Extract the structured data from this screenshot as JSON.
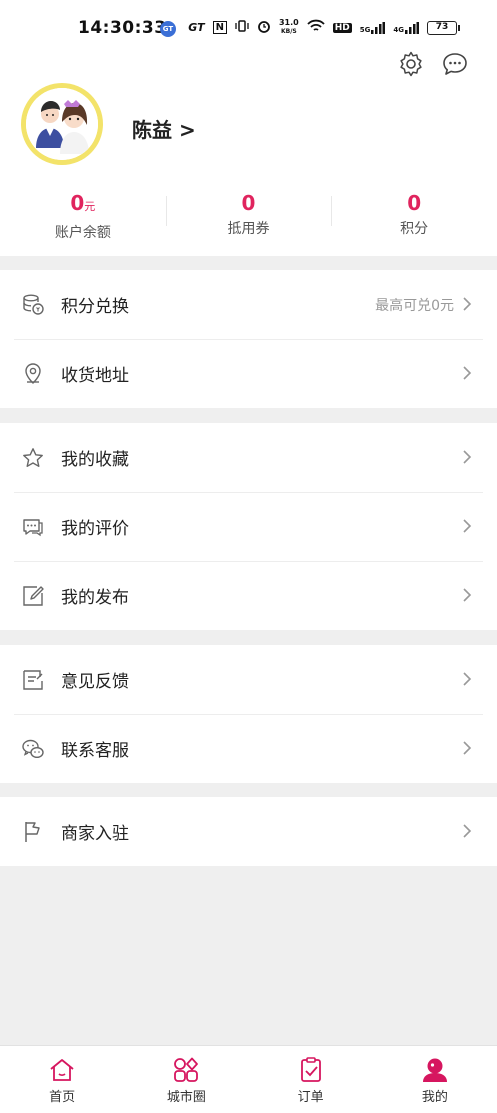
{
  "status_bar": {
    "time": "14:30:33",
    "app_badge": "GT",
    "carrier_tag": "GT",
    "nfc": "N",
    "net_speed_value": "31.0",
    "net_speed_unit": "KB/S",
    "hd_badge": "HD",
    "signal_1": "5G",
    "signal_2": "4G",
    "battery": "73"
  },
  "profile": {
    "username": "陈益 >",
    "stats": [
      {
        "value": "0",
        "unit": "元",
        "label": "账户余额"
      },
      {
        "value": "0",
        "unit": "",
        "label": "抵用券"
      },
      {
        "value": "0",
        "unit": "",
        "label": "积分"
      }
    ]
  },
  "groups": [
    {
      "rows": [
        {
          "icon": "coins-icon",
          "label": "积分兑换",
          "hint": "最高可兑0元"
        },
        {
          "icon": "location-pin-icon",
          "label": "收货地址",
          "hint": ""
        }
      ]
    },
    {
      "rows": [
        {
          "icon": "star-icon",
          "label": "我的收藏",
          "hint": ""
        },
        {
          "icon": "comment-icon",
          "label": "我的评价",
          "hint": ""
        },
        {
          "icon": "edit-icon",
          "label": "我的发布",
          "hint": ""
        }
      ]
    },
    {
      "rows": [
        {
          "icon": "feedback-icon",
          "label": "意见反馈",
          "hint": ""
        },
        {
          "icon": "wechat-icon",
          "label": "联系客服",
          "hint": ""
        }
      ]
    },
    {
      "rows": [
        {
          "icon": "flag-icon",
          "label": "商家入驻",
          "hint": ""
        }
      ]
    }
  ],
  "tabbar": [
    {
      "label": "首页",
      "icon": "home-icon"
    },
    {
      "label": "城市圈",
      "icon": "city-circle-icon"
    },
    {
      "label": "订单",
      "icon": "order-icon"
    },
    {
      "label": "我的",
      "icon": "user-icon"
    }
  ],
  "colors": {
    "accent": "#e0245e",
    "active_tab": "#d6165f"
  }
}
